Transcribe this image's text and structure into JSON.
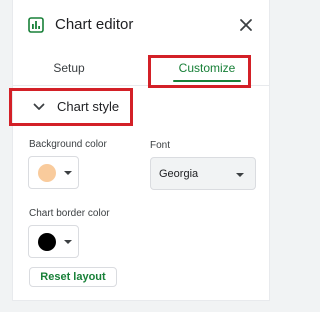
{
  "header": {
    "title": "Chart editor",
    "chart_icon": "chart-icon",
    "close_icon": "close-icon"
  },
  "tabs": [
    {
      "label": "Setup",
      "active": false
    },
    {
      "label": "Customize",
      "active": true
    }
  ],
  "section": {
    "label": "Chart style",
    "expanded": true,
    "icon": "chevron-down-icon"
  },
  "fields": {
    "background": {
      "label": "Background color",
      "color": "#f9cb9c"
    },
    "font": {
      "label": "Font",
      "value": "Georgia"
    },
    "border": {
      "label": "Chart border color",
      "color": "#000000"
    }
  },
  "reset_label": "Reset layout",
  "colors": {
    "accent": "#188038",
    "highlight": "#d32027"
  }
}
